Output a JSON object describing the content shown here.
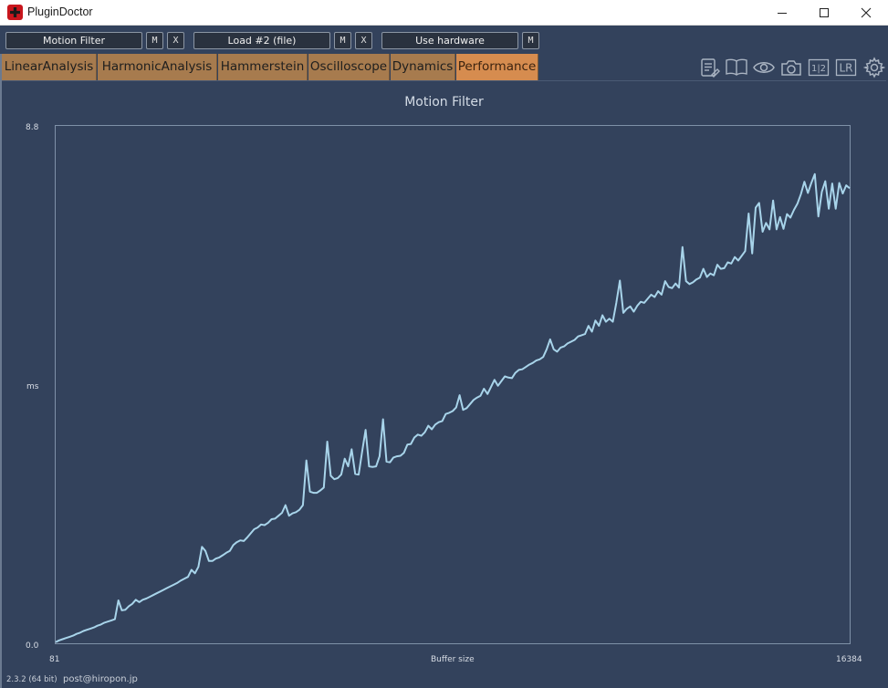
{
  "window": {
    "title": "PluginDoctor"
  },
  "toolbar": {
    "slot1_label": "Motion Filter",
    "slot1_m": "M",
    "slot1_x": "X",
    "slot2_label": "Load #2 (file)",
    "slot2_m": "M",
    "slot2_x": "X",
    "slot3_label": "Use hardware",
    "slot3_m": "M"
  },
  "tabs": [
    {
      "label": "LinearAnalysis"
    },
    {
      "label": "HarmonicAnalysis"
    },
    {
      "label": "Hammerstein"
    },
    {
      "label": "Oscilloscope"
    },
    {
      "label": "Dynamics"
    },
    {
      "label": "Performance",
      "active": true
    }
  ],
  "tool_icons": [
    "notes-icon",
    "book-icon",
    "eye-icon",
    "camera-icon",
    "channel-1-2-icon",
    "lr-icon",
    "settings-gear-icon"
  ],
  "tool_icon_labels": {
    "channel": "1|2",
    "lr": "LR"
  },
  "colors": {
    "background": "#33425c",
    "line": "#a8d4ea",
    "tab": "#a77b4e",
    "tab_active": "#d68c4f"
  },
  "chart_data": {
    "type": "line",
    "title": "Motion Filter",
    "xlabel": "Buffer size",
    "ylabel": "ms",
    "xlim": [
      81,
      16384
    ],
    "ylim": [
      0.0,
      8.8
    ],
    "x_tick_labels": [
      "81",
      "16384"
    ],
    "y_tick_labels": [
      "0.0",
      "8.8"
    ],
    "y": [
      0.02,
      0.05,
      0.07,
      0.09,
      0.11,
      0.13,
      0.16,
      0.18,
      0.21,
      0.23,
      0.25,
      0.27,
      0.3,
      0.32,
      0.35,
      0.37,
      0.39,
      0.41,
      0.73,
      0.56,
      0.57,
      0.63,
      0.67,
      0.74,
      0.7,
      0.74,
      0.76,
      0.79,
      0.82,
      0.85,
      0.88,
      0.91,
      0.94,
      0.97,
      1.0,
      1.03,
      1.07,
      1.1,
      1.13,
      1.25,
      1.19,
      1.3,
      1.64,
      1.57,
      1.4,
      1.4,
      1.44,
      1.46,
      1.5,
      1.54,
      1.57,
      1.67,
      1.72,
      1.75,
      1.74,
      1.8,
      1.87,
      1.94,
      1.97,
      2.02,
      2.01,
      2.05,
      2.11,
      2.12,
      2.17,
      2.22,
      2.35,
      2.17,
      2.21,
      2.23,
      2.27,
      2.35,
      3.11,
      2.58,
      2.56,
      2.56,
      2.6,
      2.65,
      3.43,
      2.85,
      2.79,
      2.81,
      2.87,
      3.14,
      3.01,
      3.3,
      2.88,
      2.87,
      3.26,
      3.63,
      3.01,
      3.0,
      3.01,
      3.18,
      3.81,
      3.09,
      3.08,
      3.16,
      3.18,
      3.19,
      3.24,
      3.38,
      3.39,
      3.5,
      3.55,
      3.53,
      3.59,
      3.7,
      3.64,
      3.72,
      3.76,
      3.78,
      3.9,
      3.92,
      3.95,
      4.01,
      4.22,
      3.97,
      4.0,
      4.07,
      4.14,
      4.18,
      4.21,
      4.33,
      4.24,
      4.36,
      4.48,
      4.38,
      4.46,
      4.54,
      4.52,
      4.51,
      4.6,
      4.65,
      4.66,
      4.7,
      4.74,
      4.77,
      4.81,
      4.83,
      4.87,
      5.0,
      5.17,
      5.0,
      4.96,
      5.03,
      5.05,
      5.1,
      5.13,
      5.16,
      5.22,
      5.24,
      5.26,
      5.4,
      5.3,
      5.49,
      5.4,
      5.58,
      5.47,
      5.52,
      5.47,
      5.79,
      6.17,
      5.62,
      5.69,
      5.73,
      5.64,
      5.74,
      5.81,
      5.79,
      5.86,
      5.93,
      5.89,
      5.99,
      5.93,
      6.16,
      6.06,
      6.04,
      6.12,
      6.05,
      6.74,
      6.16,
      6.11,
      6.14,
      6.19,
      6.22,
      6.37,
      6.23,
      6.29,
      6.26,
      6.44,
      6.37,
      6.38,
      6.48,
      6.46,
      6.57,
      6.51,
      6.59,
      6.67,
      7.31,
      6.63,
      7.41,
      7.49,
      7.0,
      7.15,
      7.04,
      7.53,
      7.04,
      7.25,
      7.05,
      7.3,
      7.24,
      7.37,
      7.48,
      7.64,
      7.85,
      7.66,
      7.83,
      7.98,
      7.26,
      7.68,
      7.86,
      7.39,
      7.82,
      7.39,
      7.83,
      7.65,
      7.79,
      7.74
    ]
  },
  "footer": {
    "version": "2.3.2 (64 bit)",
    "email": "post@hiropon.jp"
  }
}
